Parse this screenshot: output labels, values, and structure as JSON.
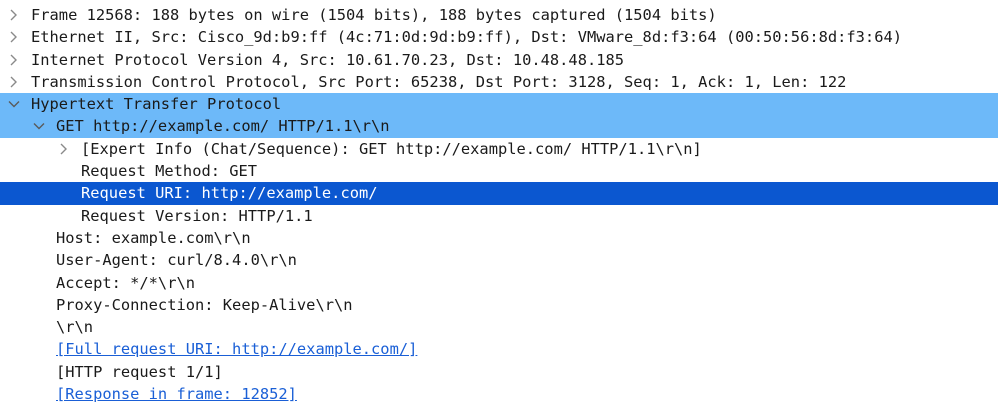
{
  "colors": {
    "highlight_light": "#6db9f9",
    "highlight_strong": "#0b57d0",
    "link": "#1a5fd6",
    "arrow": "#8a8a8a"
  },
  "tree": {
    "frame": "Frame 12568: 188 bytes on wire (1504 bits), 188 bytes captured (1504 bits)",
    "ethernet": "Ethernet II, Src: Cisco_9d:b9:ff (4c:71:0d:9d:b9:ff), Dst: VMware_8d:f3:64 (00:50:56:8d:f3:64)",
    "ip": "Internet Protocol Version 4, Src: 10.61.70.23, Dst: 10.48.48.185",
    "tcp": "Transmission Control Protocol, Src Port: 65238, Dst Port: 3128, Seq: 1, Ack: 1, Len: 122",
    "http": "Hypertext Transfer Protocol",
    "get_line": "GET http://example.com/ HTTP/1.1\\r\\n",
    "expert_info": "[Expert Info (Chat/Sequence): GET http://example.com/ HTTP/1.1\\r\\n]",
    "request_method": "Request Method: GET",
    "request_uri": "Request URI: http://example.com/",
    "request_version": "Request Version: HTTP/1.1",
    "host": "Host: example.com\\r\\n",
    "user_agent": "User-Agent: curl/8.4.0\\r\\n",
    "accept": "Accept: */*\\r\\n",
    "proxy_connection": "Proxy-Connection: Keep-Alive\\r\\n",
    "crlf": "\\r\\n",
    "full_request_uri": "[Full request URI: http://example.com/]",
    "http_request": "[HTTP request 1/1]",
    "response_in_frame": "[Response in frame: 12852]"
  },
  "icons": {
    "collapsed": "chevron-right-icon",
    "expanded": "chevron-down-icon"
  }
}
